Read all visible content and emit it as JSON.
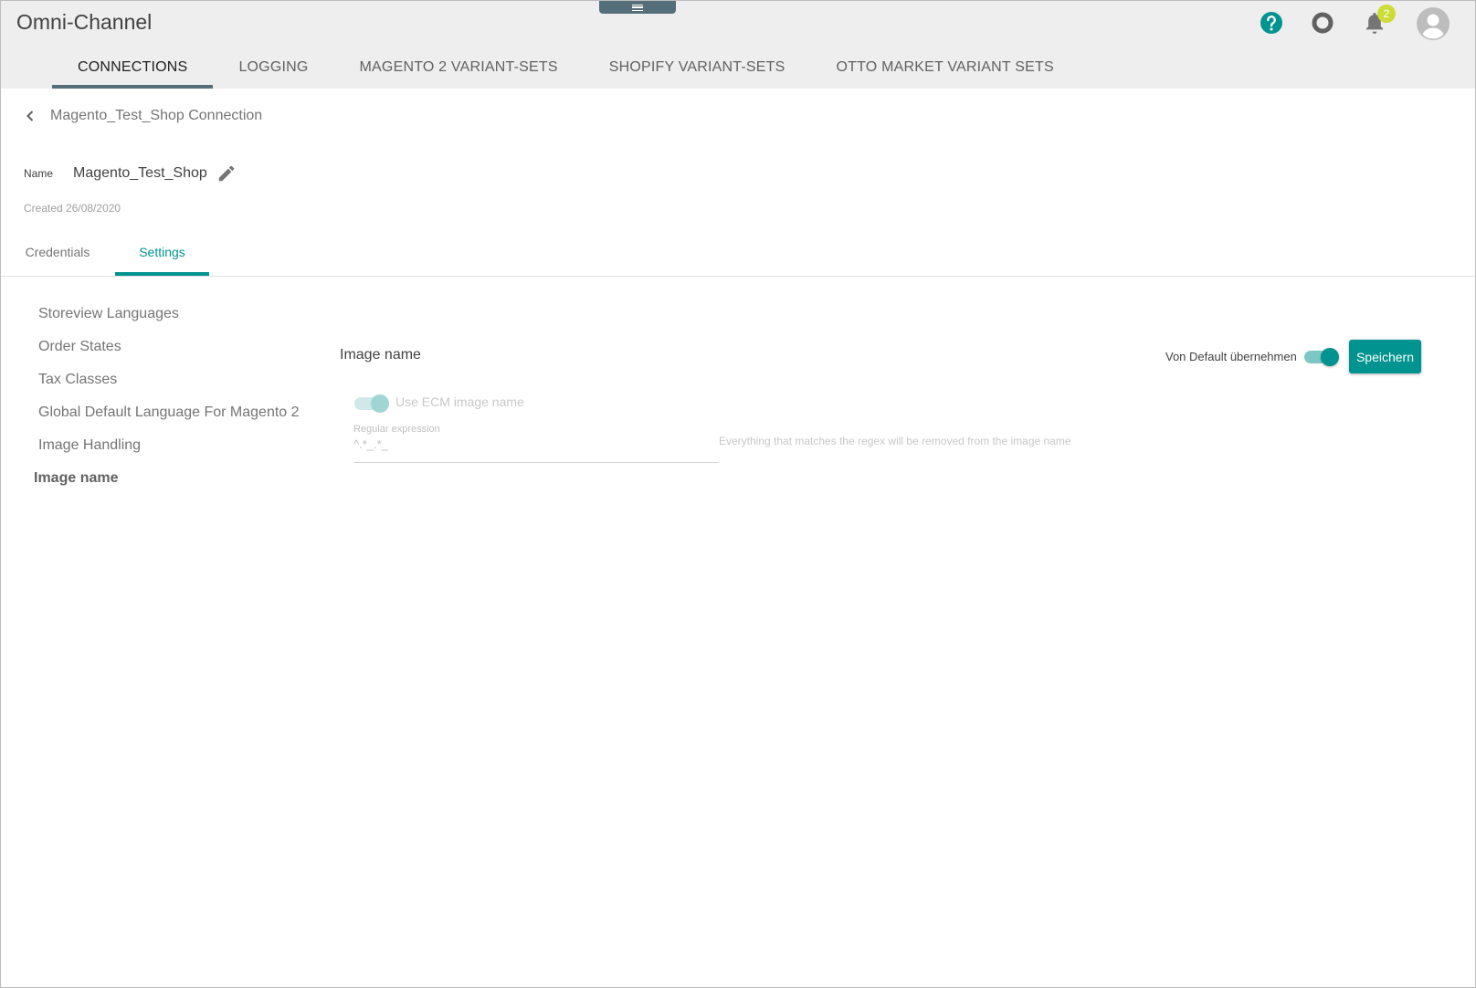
{
  "app": {
    "title": "Omni-Channel"
  },
  "header": {
    "notification_count": "2",
    "icons": {
      "help": "help-circle-icon",
      "status": "ring-icon",
      "notifications": "bell-icon",
      "user": "avatar-icon"
    },
    "accent_color": "#00938f"
  },
  "topnav": {
    "tabs": [
      {
        "label": "CONNECTIONS",
        "active": true
      },
      {
        "label": "LOGGING",
        "active": false
      },
      {
        "label": "MAGENTO 2 VARIANT-SETS",
        "active": false
      },
      {
        "label": "SHOPIFY VARIANT-SETS",
        "active": false
      },
      {
        "label": "OTTO MARKET VARIANT SETS",
        "active": false
      }
    ]
  },
  "breadcrumb": {
    "title": "Magento_Test_Shop Connection"
  },
  "connection": {
    "name_label": "Name",
    "name_value": "Magento_Test_Shop",
    "created": "Created 26/08/2020"
  },
  "subtabs": {
    "credentials": "Credentials",
    "settings": "Settings",
    "active": "settings"
  },
  "settings_menu": {
    "items": [
      "Storeview Languages",
      "Order States",
      "Tax Classes",
      "Global Default Language For Magento 2",
      "Image Handling",
      "Image name"
    ],
    "active_index": 5
  },
  "panel": {
    "title": "Image name",
    "default_toggle_label": "Von Default übernehmen",
    "default_toggle_on": true,
    "save_label": "Speichern",
    "ecm_toggle_label": "Use ECM image name",
    "ecm_toggle_on": true,
    "regex_label": "Regular expression",
    "regex_value": "^.*_.*_",
    "regex_hint": "Everything that matches the regex will be removed from the image name"
  }
}
